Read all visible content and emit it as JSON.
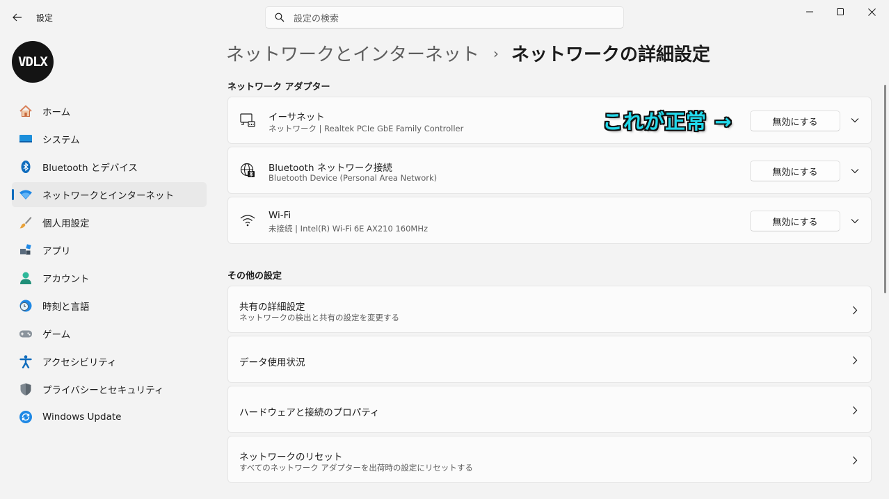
{
  "titlebar": {
    "app_title": "設定",
    "search_placeholder": "設定の検索"
  },
  "sidebar": {
    "avatar_text": "VDLX",
    "items": [
      {
        "label": "ホーム",
        "icon": "home-icon"
      },
      {
        "label": "システム",
        "icon": "system-icon"
      },
      {
        "label": "Bluetooth とデバイス",
        "icon": "bluetooth-icon"
      },
      {
        "label": "ネットワークとインターネット",
        "icon": "network-icon",
        "active": true
      },
      {
        "label": "個人用設定",
        "icon": "brush-icon"
      },
      {
        "label": "アプリ",
        "icon": "apps-icon"
      },
      {
        "label": "アカウント",
        "icon": "account-icon"
      },
      {
        "label": "時刻と言語",
        "icon": "time-language-icon"
      },
      {
        "label": "ゲーム",
        "icon": "gamepad-icon"
      },
      {
        "label": "アクセシビリティ",
        "icon": "accessibility-icon"
      },
      {
        "label": "プライバシーとセキュリティ",
        "icon": "shield-icon"
      },
      {
        "label": "Windows Update",
        "icon": "windows-update-icon"
      }
    ]
  },
  "breadcrumb": {
    "parent": "ネットワークとインターネット",
    "separator": "›",
    "current": "ネットワークの詳細設定"
  },
  "adapters_section": {
    "title": "ネットワーク アダプター",
    "button_label": "無効にする",
    "items": [
      {
        "title": "イーサネット",
        "subtitle": "ネットワーク | Realtek PCIe GbE Family Controller",
        "icon": "ethernet-icon"
      },
      {
        "title": "Bluetooth ネットワーク接続",
        "subtitle": "Bluetooth Device (Personal Area Network)",
        "icon": "bluetooth-network-icon"
      },
      {
        "title": "Wi-Fi",
        "subtitle": "未接続 | Intel(R) Wi-Fi 6E AX210 160MHz",
        "icon": "wifi-icon"
      }
    ]
  },
  "annotation": {
    "text": "これが正常 →",
    "color": "#22d8ea"
  },
  "other_section": {
    "title": "その他の設定",
    "items": [
      {
        "title": "共有の詳細設定",
        "subtitle": "ネットワークの検出と共有の設定を変更する"
      },
      {
        "title": "データ使用状況",
        "subtitle": ""
      },
      {
        "title": "ハードウェアと接続のプロパティ",
        "subtitle": ""
      },
      {
        "title": "ネットワークのリセット",
        "subtitle": "すべてのネットワーク アダプターを出荷時の設定にリセットする"
      }
    ]
  },
  "colors": {
    "accent": "#0f6cbd",
    "background": "#f3f3f3",
    "card": "#fbfbfb"
  }
}
